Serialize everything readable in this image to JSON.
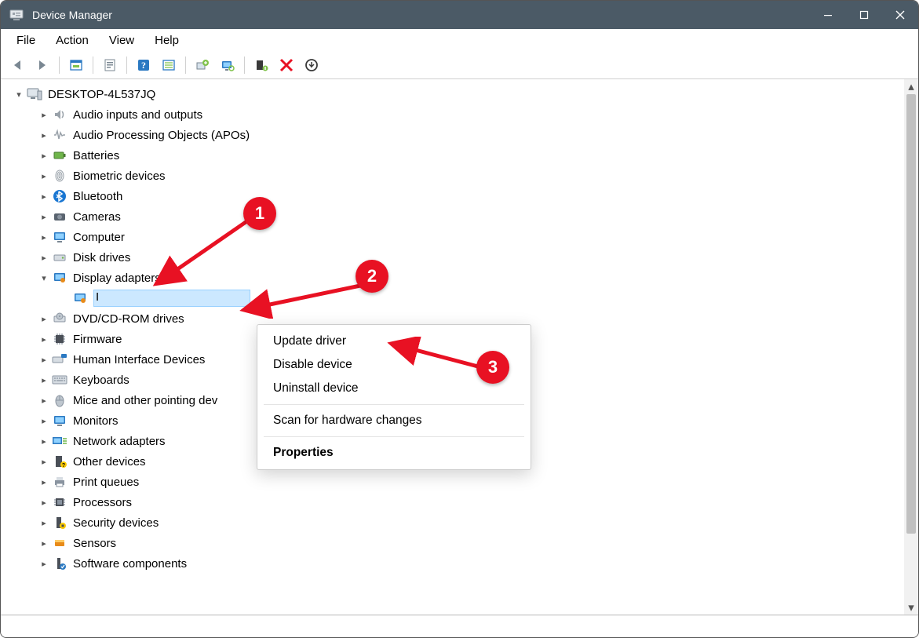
{
  "title": "Device Manager",
  "menus": {
    "file": "File",
    "action": "Action",
    "view": "View",
    "help": "Help"
  },
  "toolbar_icons": [
    "back",
    "forward",
    "|",
    "show-hidden",
    "|",
    "properties",
    "|",
    "help",
    "list",
    "|",
    "update",
    "monitor",
    "|",
    "enable",
    "disable",
    "uninstall"
  ],
  "root": "DESKTOP-4L537JQ",
  "categories": [
    {
      "id": "audio-inputs-outputs",
      "label": "Audio inputs and outputs"
    },
    {
      "id": "audio-processing",
      "label": "Audio Processing Objects (APOs)"
    },
    {
      "id": "batteries",
      "label": "Batteries"
    },
    {
      "id": "biometric",
      "label": "Biometric devices"
    },
    {
      "id": "bluetooth",
      "label": "Bluetooth"
    },
    {
      "id": "cameras",
      "label": "Cameras"
    },
    {
      "id": "computer",
      "label": "Computer"
    },
    {
      "id": "disk-drives",
      "label": "Disk drives"
    },
    {
      "id": "display-adapters",
      "label": "Display adapters",
      "expanded": true
    },
    {
      "id": "dvd-cd",
      "label": "DVD/CD-ROM drives"
    },
    {
      "id": "firmware",
      "label": "Firmware"
    },
    {
      "id": "hid",
      "label": "Human Interface Devices"
    },
    {
      "id": "keyboards",
      "label": "Keyboards"
    },
    {
      "id": "mice",
      "label": "Mice and other pointing dev"
    },
    {
      "id": "monitors",
      "label": "Monitors"
    },
    {
      "id": "network",
      "label": "Network adapters"
    },
    {
      "id": "other",
      "label": "Other devices"
    },
    {
      "id": "print-queues",
      "label": "Print queues"
    },
    {
      "id": "processors",
      "label": "Processors"
    },
    {
      "id": "security",
      "label": "Security devices"
    },
    {
      "id": "sensors",
      "label": "Sensors"
    },
    {
      "id": "software-components",
      "label": "Software components"
    }
  ],
  "selected_device_visible_text": "I",
  "context_menu": {
    "update": "Update driver",
    "disable": "Disable device",
    "uninstall": "Uninstall device",
    "scan": "Scan for hardware changes",
    "properties": "Properties"
  },
  "annotations": {
    "b1": "1",
    "b2": "2",
    "b3": "3"
  }
}
